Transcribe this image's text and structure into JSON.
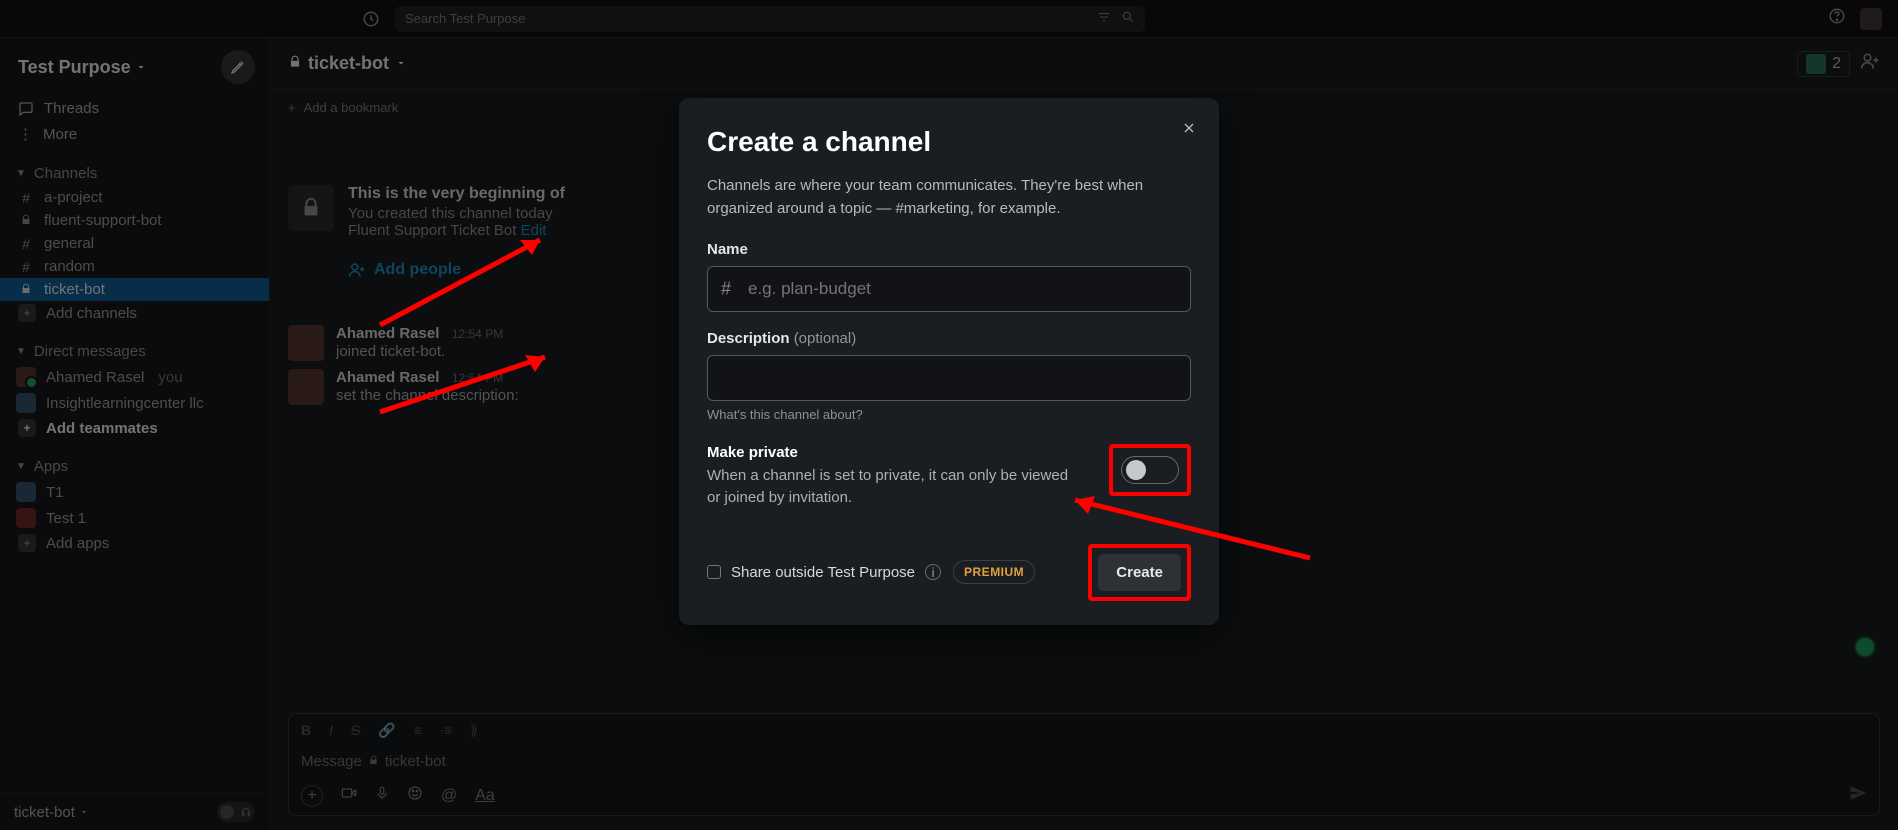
{
  "topbar": {
    "search_placeholder": "Search Test Purpose"
  },
  "workspace": {
    "name": "Test Purpose"
  },
  "sidebar": {
    "threads": "Threads",
    "more": "More",
    "channels_section": "Channels",
    "channels": [
      {
        "prefix": "#",
        "label": "a-project"
      },
      {
        "prefix": "lock",
        "label": "fluent-support-bot"
      },
      {
        "prefix": "#",
        "label": "general"
      },
      {
        "prefix": "#",
        "label": "random"
      },
      {
        "prefix": "lock",
        "label": "ticket-bot",
        "active": true
      }
    ],
    "add_channels": "Add channels",
    "dms_section": "Direct messages",
    "dms": [
      {
        "name": "Ahamed Rasel",
        "suffix": "you"
      },
      {
        "name": "Insightlearningcenter llc"
      }
    ],
    "add_teammates": "Add teammates",
    "apps_section": "Apps",
    "apps": [
      {
        "name": "T1"
      },
      {
        "name": "Test 1"
      }
    ],
    "add_apps": "Add apps",
    "footer_channel": "ticket-bot"
  },
  "channel": {
    "name": "ticket-bot",
    "member_count": "2",
    "add_bookmark": "Add a bookmark",
    "intro_title": "This is the very beginning of",
    "intro_line1": "You created this channel today",
    "intro_line2_pre": "Fluent Support Ticket Bot ",
    "intro_link": "Edit",
    "add_people": "Add people"
  },
  "messages": [
    {
      "name": "Ahamed Rasel",
      "time": "12:54 PM",
      "text": "joined ticket-bot."
    },
    {
      "name": "Ahamed Rasel",
      "time": "12:54 PM",
      "text": "set the channel description:"
    }
  ],
  "composer": {
    "placeholder_pre": "Message ",
    "placeholder_channel": "ticket-bot"
  },
  "modal": {
    "title": "Create a channel",
    "description": "Channels are where your team communicates. They're best when organized around a topic — #marketing, for example.",
    "name_label": "Name",
    "name_placeholder": "e.g. plan-budget",
    "desc_label": "Description",
    "desc_optional": "(optional)",
    "desc_hint": "What's this channel about?",
    "private_title": "Make private",
    "private_sub": "When a channel is set to private, it can only be viewed or joined by invitation.",
    "share_label": "Share outside Test Purpose",
    "premium": "PREMIUM",
    "create": "Create"
  }
}
